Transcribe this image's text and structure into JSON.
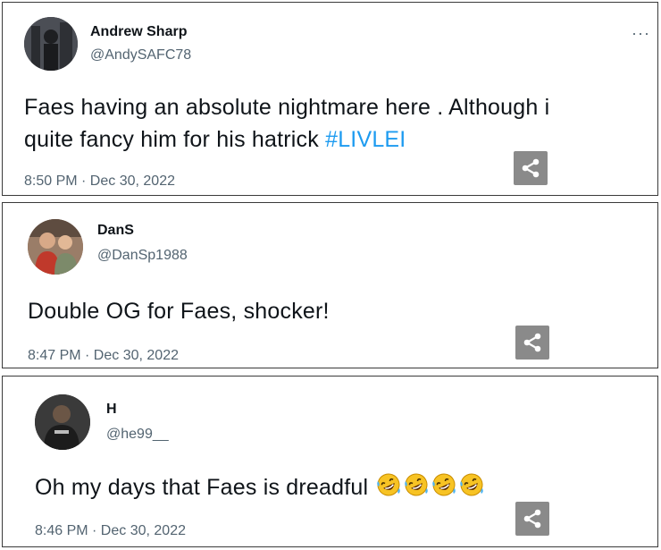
{
  "tweets": [
    {
      "name": "Andrew Sharp",
      "handle": "@AndySAFC78",
      "text_line1": "Faes  having an absolute  nightmare  here . Although  i",
      "text_line2": "quite fancy him for his hatrick ",
      "hashtag": "#LIVLEI",
      "timestamp": "8:50 PM · Dec 30, 2022",
      "more": "···"
    },
    {
      "name": "DanS",
      "handle": "@DanSp1988",
      "text": "Double OG for Faes, shocker!",
      "timestamp": "8:47 PM · Dec 30, 2022"
    },
    {
      "name": "H",
      "handle": "@he99__",
      "text": "Oh my days that Faes is dreadful ",
      "emojis": [
        "rolling-on-floor-laughing",
        "rolling-on-floor-laughing",
        "rolling-on-floor-laughing",
        "rolling-on-floor-laughing"
      ],
      "timestamp": "8:46 PM · Dec 30, 2022"
    }
  ],
  "colors": {
    "hashtag": "#1d9bf0",
    "secondary_text": "#536471",
    "share_button": "#8a8a8a"
  }
}
